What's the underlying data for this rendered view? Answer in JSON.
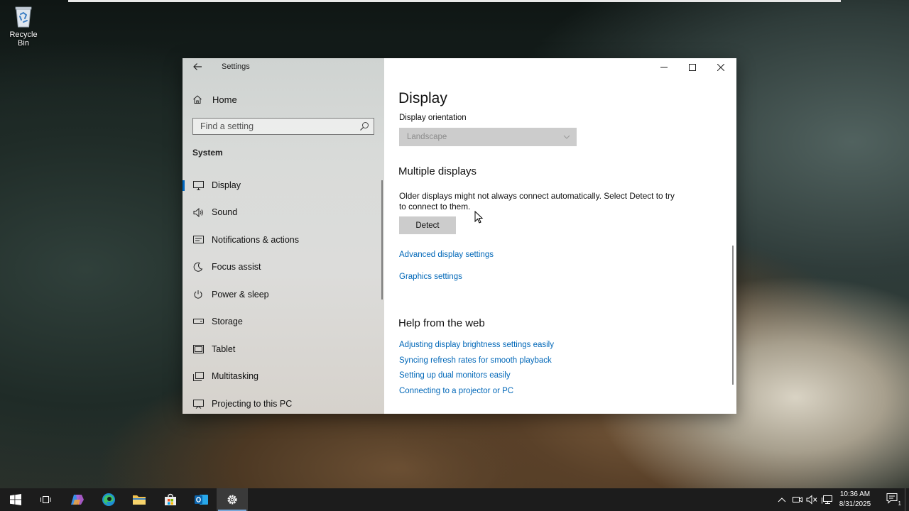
{
  "desktop": {
    "icons": [
      {
        "label": "Recycle Bin",
        "icon": "recycle-bin-icon"
      }
    ]
  },
  "window": {
    "title": "Settings",
    "nav": {
      "home_label": "Home",
      "search_placeholder": "Find a setting",
      "section_label": "System",
      "items": [
        {
          "label": "Display",
          "icon": "monitor-icon",
          "active": true
        },
        {
          "label": "Sound",
          "icon": "speaker-icon"
        },
        {
          "label": "Notifications & actions",
          "icon": "notification-icon"
        },
        {
          "label": "Focus assist",
          "icon": "moon-icon"
        },
        {
          "label": "Power & sleep",
          "icon": "power-icon"
        },
        {
          "label": "Storage",
          "icon": "storage-icon"
        },
        {
          "label": "Tablet",
          "icon": "tablet-icon"
        },
        {
          "label": "Multitasking",
          "icon": "multitasking-icon"
        },
        {
          "label": "Projecting to this PC",
          "icon": "projecting-icon"
        }
      ]
    },
    "content": {
      "title": "Display",
      "orientation_label": "Display orientation",
      "orientation_value": "Landscape",
      "multiple_displays_title": "Multiple displays",
      "multiple_displays_text": "Older displays might not always connect automatically. Select Detect to try to connect to them.",
      "detect_label": "Detect",
      "links": [
        "Advanced display settings",
        "Graphics settings"
      ],
      "help_title": "Help from the web",
      "help_links": [
        "Adjusting display brightness settings easily",
        "Syncing refresh rates for smooth playback",
        "Setting up dual monitors easily",
        "Connecting to a projector or PC"
      ]
    }
  },
  "taskbar": {
    "apps": [
      {
        "name": "start-button",
        "icon": "windows-logo-icon"
      },
      {
        "name": "task-view-button",
        "icon": "task-view-icon"
      },
      {
        "name": "copilot-button",
        "icon": "copilot-icon"
      },
      {
        "name": "edge-button",
        "icon": "edge-icon"
      },
      {
        "name": "file-explorer-button",
        "icon": "folder-icon"
      },
      {
        "name": "store-button",
        "icon": "store-icon"
      },
      {
        "name": "outlook-button",
        "icon": "outlook-icon"
      },
      {
        "name": "settings-button",
        "icon": "gear-icon",
        "active": true
      }
    ],
    "time": "10:36 AM",
    "date": "8/31/2025",
    "notification_count": "1"
  },
  "colors": {
    "accent": "#0067c0",
    "link": "#0067b8",
    "taskbar": "#1c1c1c"
  }
}
